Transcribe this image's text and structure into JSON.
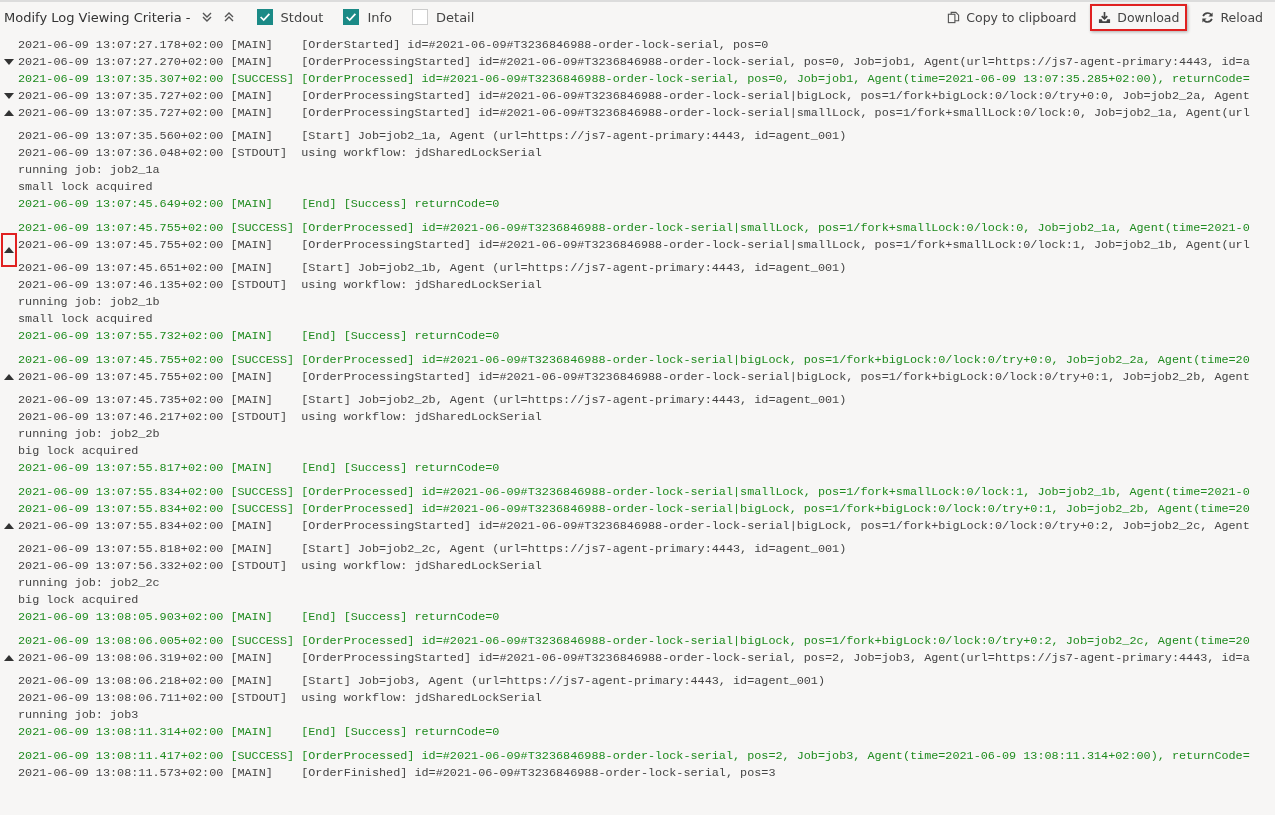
{
  "toolbar": {
    "title": "Modify Log Viewing Criteria -",
    "filters": [
      {
        "label": "Stdout",
        "checked": true
      },
      {
        "label": "Info",
        "checked": true
      },
      {
        "label": "Detail",
        "checked": false
      }
    ],
    "actions": [
      {
        "kind": "copy",
        "label": "Copy to clipboard",
        "highlighted": false
      },
      {
        "kind": "download",
        "label": "Download",
        "highlighted": true
      },
      {
        "kind": "reload",
        "label": "Reload",
        "highlighted": false
      }
    ]
  },
  "log": [
    {
      "kind": "main",
      "time": "2021-06-09 13:07:27.178+02:00",
      "level": "[MAIN]",
      "message": "[OrderStarted] id=#2021-06-09#T3236846988-order-lock-serial, pos=0"
    },
    {
      "kind": "main",
      "time": "2021-06-09 13:07:27.270+02:00",
      "level": "[MAIN]",
      "message": "[OrderProcessingStarted] id=#2021-06-09#T3236846988-order-lock-serial, pos=0, Job=job1, Agent(url=https://js7-agent-primary:4443, id=a",
      "expanded": false,
      "highlighted": false
    },
    {
      "kind": "success",
      "time": "2021-06-09 13:07:35.307+02:00",
      "level": "[SUCCESS]",
      "message": "[OrderProcessed] id=#2021-06-09#T3236846988-order-lock-serial, pos=0, Job=job1, Agent(time=2021-06-09 13:07:35.285+02:00), returnCode="
    },
    {
      "kind": "main",
      "time": "2021-06-09 13:07:35.727+02:00",
      "level": "[MAIN]",
      "message": "[OrderProcessingStarted] id=#2021-06-09#T3236846988-order-lock-serial|bigLock, pos=1/fork+bigLock:0/lock:0/try+0:0, Job=job2_2a, Agent",
      "expanded": false,
      "highlighted": false
    },
    {
      "kind": "main",
      "time": "2021-06-09 13:07:35.727+02:00",
      "level": "[MAIN]",
      "message": "[OrderProcessingStarted] id=#2021-06-09#T3236846988-order-lock-serial|smallLock, pos=1/fork+smallLock:0/lock:0, Job=job2_1a, Agent(url",
      "expanded": true,
      "highlighted": false,
      "children": [
        {
          "kind": "main",
          "time": "2021-06-09 13:07:35.560+02:00",
          "level": "[MAIN]",
          "message": "[Start] Job=job2_1a, Agent (url=https://js7-agent-primary:4443, id=agent_001)"
        },
        {
          "kind": "stdout",
          "time": "2021-06-09 13:07:36.048+02:00",
          "level": "[STDOUT]",
          "message": "using workflow: jdSharedLockSerial"
        },
        {
          "kind": "output",
          "message": "running job: job2_1a"
        },
        {
          "kind": "output",
          "message": "small lock acquired"
        },
        {
          "kind": "success",
          "time": "2021-06-09 13:07:45.649+02:00",
          "level": "[MAIN]",
          "message": "[End] [Success] returnCode=0"
        }
      ]
    },
    {
      "kind": "success",
      "time": "2021-06-09 13:07:45.755+02:00",
      "level": "[SUCCESS]",
      "message": "[OrderProcessed] id=#2021-06-09#T3236846988-order-lock-serial|smallLock, pos=1/fork+smallLock:0/lock:0, Job=job2_1a, Agent(time=2021-0"
    },
    {
      "kind": "main",
      "time": "2021-06-09 13:07:45.755+02:00",
      "level": "[MAIN]",
      "message": "[OrderProcessingStarted] id=#2021-06-09#T3236846988-order-lock-serial|smallLock, pos=1/fork+smallLock:0/lock:1, Job=job2_1b, Agent(url",
      "expanded": true,
      "highlighted": true,
      "children": [
        {
          "kind": "main",
          "time": "2021-06-09 13:07:45.651+02:00",
          "level": "[MAIN]",
          "message": "[Start] Job=job2_1b, Agent (url=https://js7-agent-primary:4443, id=agent_001)"
        },
        {
          "kind": "stdout",
          "time": "2021-06-09 13:07:46.135+02:00",
          "level": "[STDOUT]",
          "message": "using workflow: jdSharedLockSerial"
        },
        {
          "kind": "output",
          "message": "running job: job2_1b"
        },
        {
          "kind": "output",
          "message": "small lock acquired"
        },
        {
          "kind": "success",
          "time": "2021-06-09 13:07:55.732+02:00",
          "level": "[MAIN]",
          "message": "[End] [Success] returnCode=0"
        }
      ]
    },
    {
      "kind": "success",
      "time": "2021-06-09 13:07:45.755+02:00",
      "level": "[SUCCESS]",
      "message": "[OrderProcessed] id=#2021-06-09#T3236846988-order-lock-serial|bigLock, pos=1/fork+bigLock:0/lock:0/try+0:0, Job=job2_2a, Agent(time=20"
    },
    {
      "kind": "main",
      "time": "2021-06-09 13:07:45.755+02:00",
      "level": "[MAIN]",
      "message": "[OrderProcessingStarted] id=#2021-06-09#T3236846988-order-lock-serial|bigLock, pos=1/fork+bigLock:0/lock:0/try+0:1, Job=job2_2b, Agent",
      "expanded": true,
      "highlighted": false,
      "children": [
        {
          "kind": "main",
          "time": "2021-06-09 13:07:45.735+02:00",
          "level": "[MAIN]",
          "message": "[Start] Job=job2_2b, Agent (url=https://js7-agent-primary:4443, id=agent_001)"
        },
        {
          "kind": "stdout",
          "time": "2021-06-09 13:07:46.217+02:00",
          "level": "[STDOUT]",
          "message": "using workflow: jdSharedLockSerial"
        },
        {
          "kind": "output",
          "message": "running job: job2_2b"
        },
        {
          "kind": "output",
          "message": "big lock acquired"
        },
        {
          "kind": "success",
          "time": "2021-06-09 13:07:55.817+02:00",
          "level": "[MAIN]",
          "message": "[End] [Success] returnCode=0"
        }
      ]
    },
    {
      "kind": "success",
      "time": "2021-06-09 13:07:55.834+02:00",
      "level": "[SUCCESS]",
      "message": "[OrderProcessed] id=#2021-06-09#T3236846988-order-lock-serial|smallLock, pos=1/fork+smallLock:0/lock:1, Job=job2_1b, Agent(time=2021-0"
    },
    {
      "kind": "success",
      "time": "2021-06-09 13:07:55.834+02:00",
      "level": "[SUCCESS]",
      "message": "[OrderProcessed] id=#2021-06-09#T3236846988-order-lock-serial|bigLock, pos=1/fork+bigLock:0/lock:0/try+0:1, Job=job2_2b, Agent(time=20"
    },
    {
      "kind": "main",
      "time": "2021-06-09 13:07:55.834+02:00",
      "level": "[MAIN]",
      "message": "[OrderProcessingStarted] id=#2021-06-09#T3236846988-order-lock-serial|bigLock, pos=1/fork+bigLock:0/lock:0/try+0:2, Job=job2_2c, Agent",
      "expanded": true,
      "highlighted": false,
      "children": [
        {
          "kind": "main",
          "time": "2021-06-09 13:07:55.818+02:00",
          "level": "[MAIN]",
          "message": "[Start] Job=job2_2c, Agent (url=https://js7-agent-primary:4443, id=agent_001)"
        },
        {
          "kind": "stdout",
          "time": "2021-06-09 13:07:56.332+02:00",
          "level": "[STDOUT]",
          "message": "using workflow: jdSharedLockSerial"
        },
        {
          "kind": "output",
          "message": "running job: job2_2c"
        },
        {
          "kind": "output",
          "message": "big lock acquired"
        },
        {
          "kind": "success",
          "time": "2021-06-09 13:08:05.903+02:00",
          "level": "[MAIN]",
          "message": "[End] [Success] returnCode=0"
        }
      ]
    },
    {
      "kind": "success",
      "time": "2021-06-09 13:08:06.005+02:00",
      "level": "[SUCCESS]",
      "message": "[OrderProcessed] id=#2021-06-09#T3236846988-order-lock-serial|bigLock, pos=1/fork+bigLock:0/lock:0/try+0:2, Job=job2_2c, Agent(time=20"
    },
    {
      "kind": "main",
      "time": "2021-06-09 13:08:06.319+02:00",
      "level": "[MAIN]",
      "message": "[OrderProcessingStarted] id=#2021-06-09#T3236846988-order-lock-serial, pos=2, Job=job3, Agent(url=https://js7-agent-primary:4443, id=a",
      "expanded": true,
      "highlighted": false,
      "children": [
        {
          "kind": "main",
          "time": "2021-06-09 13:08:06.218+02:00",
          "level": "[MAIN]",
          "message": "[Start] Job=job3, Agent (url=https://js7-agent-primary:4443, id=agent_001)"
        },
        {
          "kind": "stdout",
          "time": "2021-06-09 13:08:06.711+02:00",
          "level": "[STDOUT]",
          "message": "using workflow: jdSharedLockSerial"
        },
        {
          "kind": "output",
          "message": "running job: job3"
        },
        {
          "kind": "success",
          "time": "2021-06-09 13:08:11.314+02:00",
          "level": "[MAIN]",
          "message": "[End] [Success] returnCode=0"
        }
      ]
    },
    {
      "kind": "success",
      "time": "2021-06-09 13:08:11.417+02:00",
      "level": "[SUCCESS]",
      "message": "[OrderProcessed] id=#2021-06-09#T3236846988-order-lock-serial, pos=2, Job=job3, Agent(time=2021-06-09 13:08:11.314+02:00), returnCode="
    },
    {
      "kind": "main",
      "time": "2021-06-09 13:08:11.573+02:00",
      "level": "[MAIN]",
      "message": "[OrderFinished] id=#2021-06-09#T3236846988-order-lock-serial, pos=3"
    }
  ]
}
